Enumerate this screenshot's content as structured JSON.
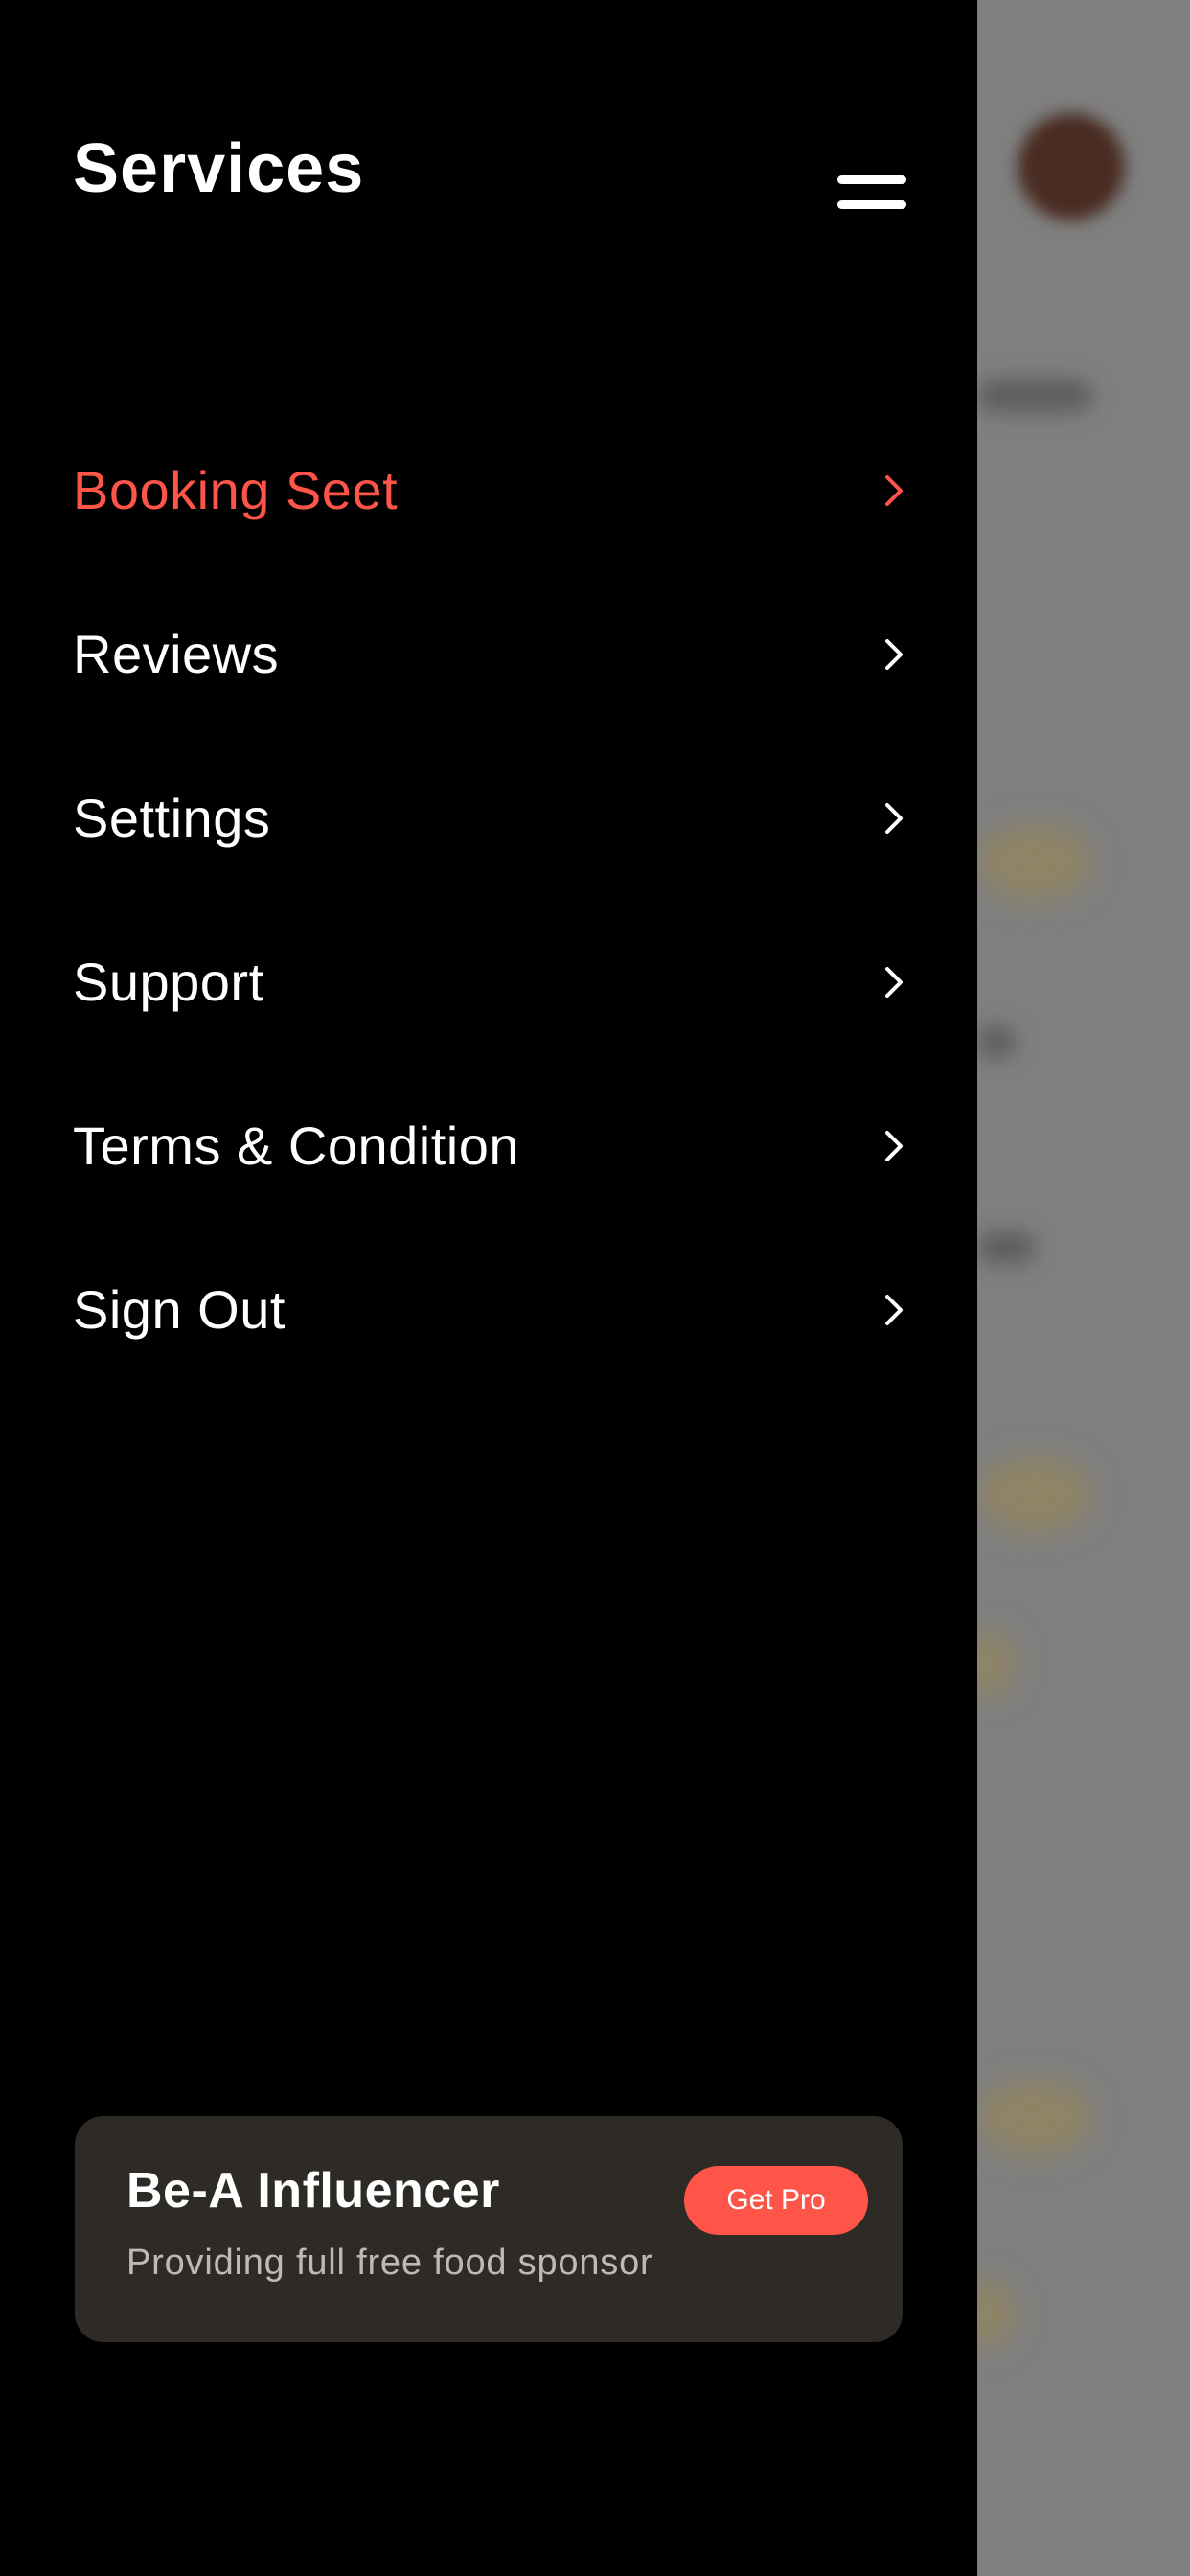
{
  "drawer": {
    "title": "Services",
    "menu_items": [
      {
        "label": "Booking Seet",
        "active": true
      },
      {
        "label": "Reviews",
        "active": false
      },
      {
        "label": "Settings",
        "active": false
      },
      {
        "label": "Support",
        "active": false
      },
      {
        "label": "Terms & Condition",
        "active": false
      },
      {
        "label": "Sign Out",
        "active": false
      }
    ]
  },
  "promo": {
    "title": "Be-A Influencer",
    "subtitle": "Providing full free food sponsor",
    "button_label": "Get Pro"
  },
  "icons": {
    "menu_toggle": "menu-toggle-icon",
    "chevron": "chevron-right-icon"
  },
  "colors": {
    "background": "#000000",
    "accent": "#ff5448",
    "text_primary": "#ffffff",
    "card_bg": "#2e2b26",
    "overlay": "#7f7f7f"
  }
}
